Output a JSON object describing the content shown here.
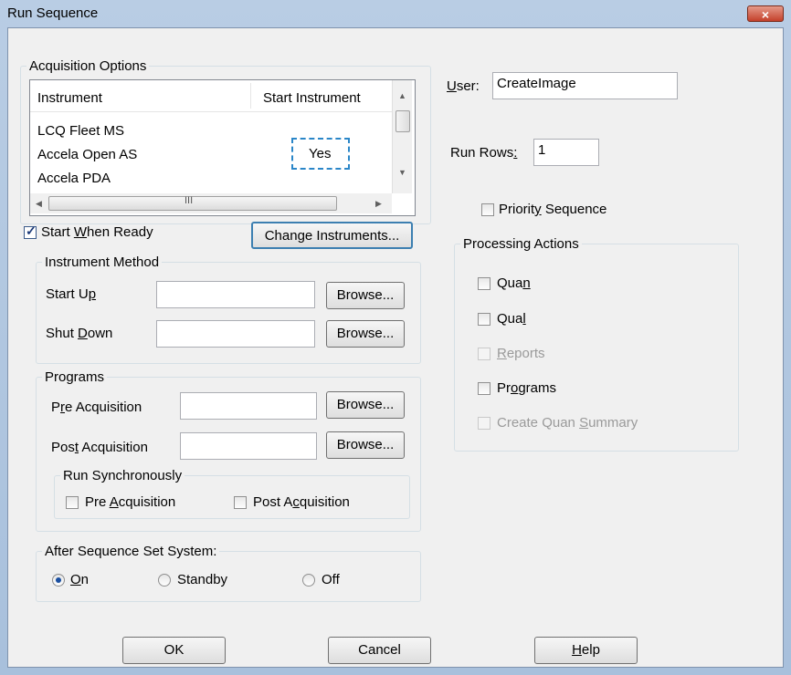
{
  "window": {
    "title": "Run Sequence",
    "close_label": "×"
  },
  "acquisition": {
    "legend": "Acquisition Options",
    "col_instrument": "Instrument",
    "col_start": "Start Instrument",
    "rows": [
      {
        "name": "LCQ Fleet MS",
        "start": ""
      },
      {
        "name": "Accela Open AS",
        "start": "Yes"
      },
      {
        "name": "Accela PDA",
        "start": ""
      }
    ],
    "hscroll_grip": "III"
  },
  "start_when_ready": {
    "pre": "Start ",
    "accel": "W",
    "post": "hen Ready",
    "checked": true
  },
  "change_instruments_label": "Change Instruments...",
  "instrument_method": {
    "legend": "Instrument Method",
    "start_up": {
      "pre": "Start U",
      "accel": "p",
      "post": "",
      "value": ""
    },
    "shut_down": {
      "pre": "Shut ",
      "accel": "D",
      "post": "own",
      "value": ""
    },
    "browse_label": "Browse..."
  },
  "programs": {
    "legend": "Programs",
    "pre_acq": {
      "pre": "P",
      "accel": "r",
      "post": "e Acquisition",
      "value": ""
    },
    "post_acq": {
      "pre": "Pos",
      "accel": "t",
      "post": " Acquisition",
      "value": ""
    },
    "browse_label": "Browse...",
    "run_sync": {
      "legend": "Run Synchronously",
      "pre": {
        "pre": "Pre ",
        "accel": "A",
        "post": "cquisition",
        "checked": false
      },
      "post": {
        "pre": "Post A",
        "accel": "c",
        "post": "quisition",
        "checked": false
      }
    }
  },
  "after_sequence": {
    "legend": "After Sequence Set System:",
    "options": [
      {
        "pre": "",
        "accel": "O",
        "post": "n",
        "selected": true
      },
      {
        "pre": "Standby",
        "accel": "",
        "post": "",
        "selected": false
      },
      {
        "pre": "Off",
        "accel": "",
        "post": "",
        "selected": false
      }
    ]
  },
  "user": {
    "pre": "",
    "accel": "U",
    "post": "ser:",
    "value": "CreateImage"
  },
  "run_rows": {
    "pre": "Run Rows",
    "accel": ":",
    "post": "",
    "value": "1"
  },
  "priority": {
    "pre": "Priorit",
    "accel": "y",
    "post": " Sequence",
    "checked": false
  },
  "processing": {
    "legend": "Processing Actions",
    "items": [
      {
        "pre": "Qua",
        "accel": "n",
        "post": "",
        "disabled": false
      },
      {
        "pre": "Qua",
        "accel": "l",
        "post": "",
        "disabled": false
      },
      {
        "pre": "",
        "accel": "R",
        "post": "eports",
        "disabled": true
      },
      {
        "pre": "Pr",
        "accel": "o",
        "post": "grams",
        "disabled": false
      },
      {
        "pre": "Create Quan ",
        "accel": "S",
        "post": "ummary",
        "disabled": true
      }
    ]
  },
  "buttons": {
    "ok": "OK",
    "cancel": "Cancel",
    "help_pre": "",
    "help_accel": "H",
    "help_post": "elp"
  }
}
